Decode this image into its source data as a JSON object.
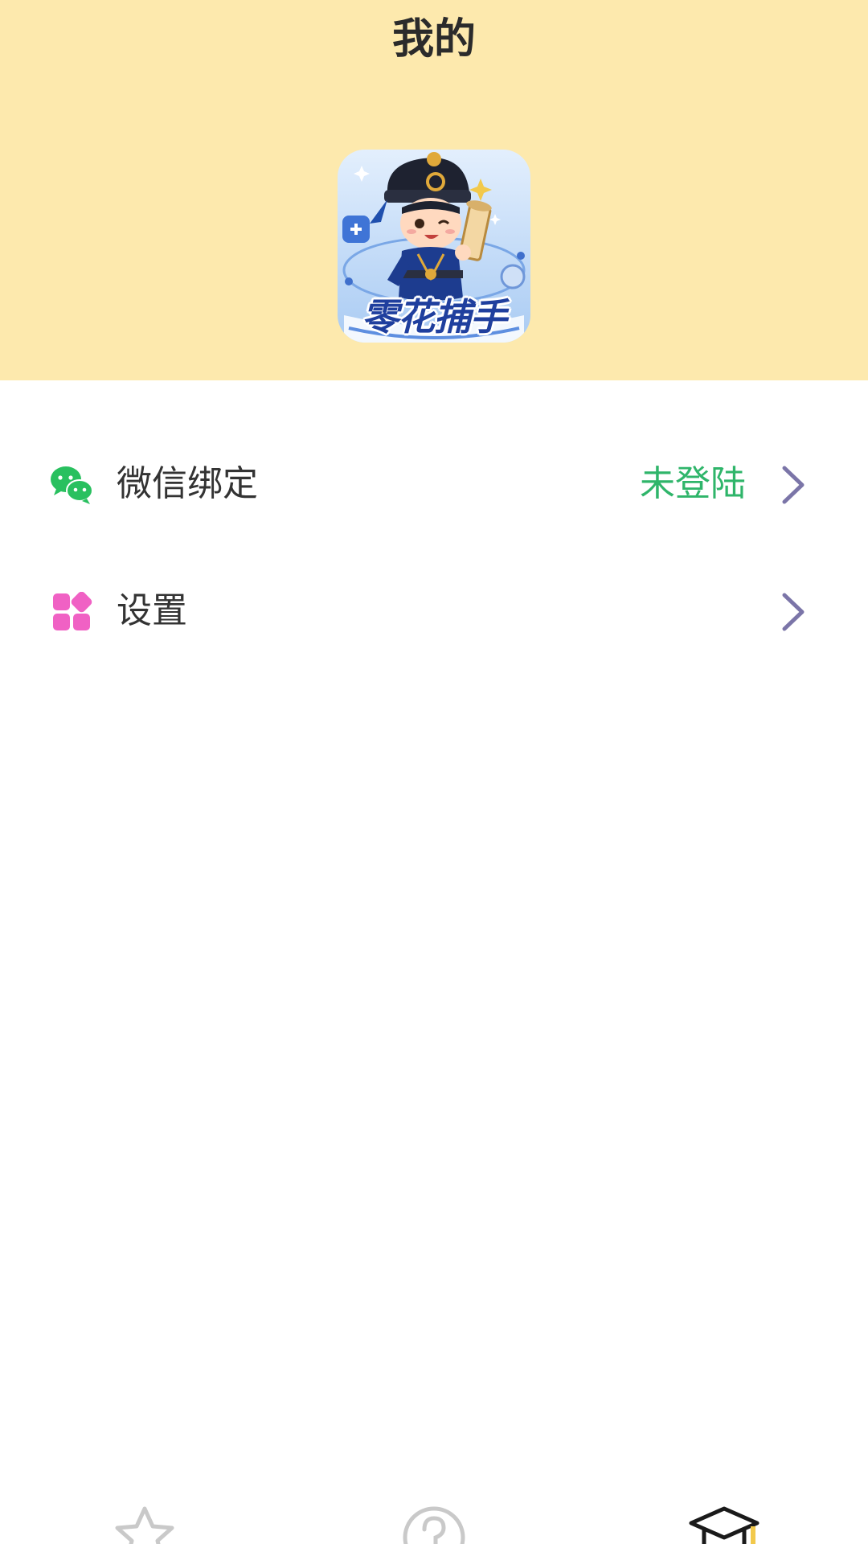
{
  "header": {
    "title": "我的",
    "logo_text": "零花捕手",
    "background_color": "#fde9ad"
  },
  "menu": [
    {
      "icon": "wechat-icon",
      "label": "微信绑定",
      "status": "未登陆",
      "status_color": "#2fb56a"
    },
    {
      "icon": "grid-apps-icon",
      "label": "设置",
      "icon_color": "#f061c4"
    }
  ],
  "tabbar": {
    "tabs": [
      {
        "icon": "star-icon"
      },
      {
        "icon": "question-icon"
      },
      {
        "icon": "graduation-cap-icon",
        "active": true
      }
    ]
  }
}
